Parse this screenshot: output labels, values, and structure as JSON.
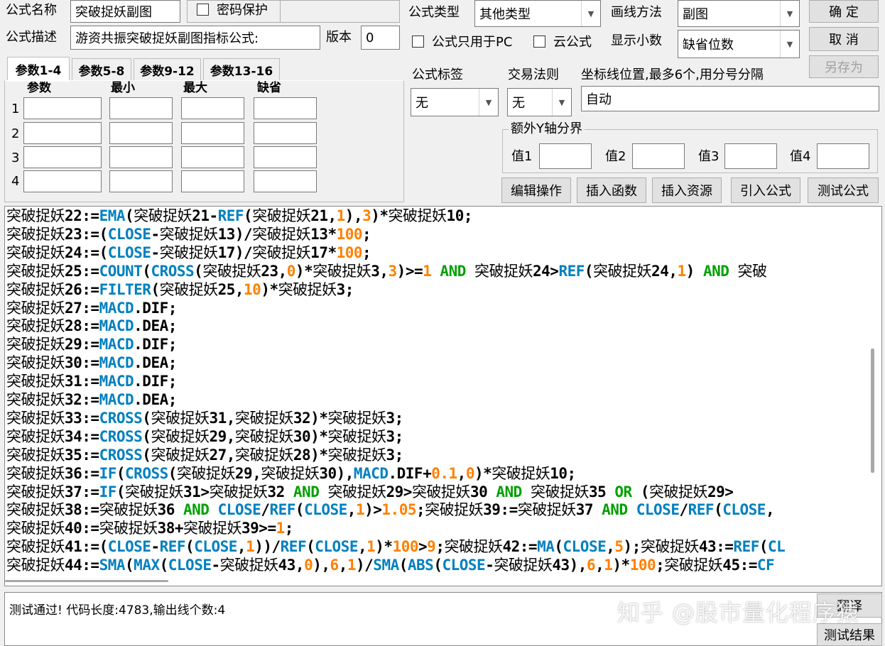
{
  "formula": {
    "name_label": "公式名称",
    "name_value": "突破捉妖副图",
    "password_label": "密码保护",
    "desc_label": "公式描述",
    "desc_value": "游资共振突破捉妖副图指标公式:",
    "version_label": "版本",
    "version_value": "0",
    "type_label": "公式类型",
    "type_value": "其他类型",
    "draw_label": "画线方法",
    "draw_value": "副图",
    "pc_only_label": "公式只用于PC",
    "cloud_label": "云公式",
    "decimals_label": "显示小数",
    "decimals_value": "缺省位数",
    "tag_label": "公式标签",
    "tag_value": "无",
    "trade_label": "交易法则",
    "trade_value": "无",
    "coord_label": "坐标线位置,最多6个,用分号分隔",
    "coord_value": "自动",
    "extra_y_label": "额外Y轴分界",
    "val1": "值1",
    "val2": "值2",
    "val3": "值3",
    "val4": "值4"
  },
  "buttons": {
    "ok": "确  定",
    "cancel": "取  消",
    "save_as": "另存为",
    "edit": "编辑操作",
    "insert_fn": "插入函数",
    "insert_res": "插入资源",
    "import": "引入公式",
    "test": "测试公式",
    "translate": "翻译",
    "test_result": "测试结果"
  },
  "tabs": [
    "参数1-4",
    "参数5-8",
    "参数9-12",
    "参数13-16"
  ],
  "params": {
    "headers": [
      "参数",
      "最小",
      "最大",
      "缺省"
    ],
    "rows": [
      "1",
      "2",
      "3",
      "4"
    ]
  },
  "code_lines": [
    [
      [
        "cn",
        "突破捉妖"
      ],
      [
        "p",
        "22:="
      ],
      [
        "f",
        "EMA"
      ],
      [
        "p",
        "("
      ],
      [
        "cn",
        "突破捉妖"
      ],
      [
        "p",
        "21-"
      ],
      [
        "f",
        "REF"
      ],
      [
        "p",
        "("
      ],
      [
        "cn",
        "突破捉妖"
      ],
      [
        "p",
        "21,"
      ],
      [
        "n",
        "1"
      ],
      [
        "p",
        "),"
      ],
      [
        "n",
        "3"
      ],
      [
        "p",
        ")*"
      ],
      [
        "cn",
        "突破捉妖"
      ],
      [
        "p",
        "10;"
      ]
    ],
    [
      [
        "cn",
        "突破捉妖"
      ],
      [
        "p",
        "23:=("
      ],
      [
        "f",
        "CLOSE"
      ],
      [
        "p",
        "-"
      ],
      [
        "cn",
        "突破捉妖"
      ],
      [
        "p",
        "13)/"
      ],
      [
        "cn",
        "突破捉妖"
      ],
      [
        "p",
        "13*"
      ],
      [
        "n",
        "100"
      ],
      [
        "p",
        ";"
      ]
    ],
    [
      [
        "cn",
        "突破捉妖"
      ],
      [
        "p",
        "24:=("
      ],
      [
        "f",
        "CLOSE"
      ],
      [
        "p",
        "-"
      ],
      [
        "cn",
        "突破捉妖"
      ],
      [
        "p",
        "17)/"
      ],
      [
        "cn",
        "突破捉妖"
      ],
      [
        "p",
        "17*"
      ],
      [
        "n",
        "100"
      ],
      [
        "p",
        ";"
      ]
    ],
    [
      [
        "cn",
        "突破捉妖"
      ],
      [
        "p",
        "25:="
      ],
      [
        "f",
        "COUNT"
      ],
      [
        "p",
        "("
      ],
      [
        "f",
        "CROSS"
      ],
      [
        "p",
        "("
      ],
      [
        "cn",
        "突破捉妖"
      ],
      [
        "p",
        "23,"
      ],
      [
        "n",
        "0"
      ],
      [
        "p",
        ")*"
      ],
      [
        "cn",
        "突破捉妖"
      ],
      [
        "p",
        "3,"
      ],
      [
        "n",
        "3"
      ],
      [
        "p",
        ")>="
      ],
      [
        "n",
        "1"
      ],
      [
        "p",
        " "
      ],
      [
        "k",
        "AND"
      ],
      [
        "p",
        " "
      ],
      [
        "cn",
        "突破捉妖"
      ],
      [
        "p",
        "24>"
      ],
      [
        "f",
        "REF"
      ],
      [
        "p",
        "("
      ],
      [
        "cn",
        "突破捉妖"
      ],
      [
        "p",
        "24,"
      ],
      [
        "n",
        "1"
      ],
      [
        "p",
        ") "
      ],
      [
        "k",
        "AND"
      ],
      [
        "p",
        " "
      ],
      [
        "cn",
        "突破"
      ]
    ],
    [
      [
        "cn",
        "突破捉妖"
      ],
      [
        "p",
        "26:="
      ],
      [
        "f",
        "FILTER"
      ],
      [
        "p",
        "("
      ],
      [
        "cn",
        "突破捉妖"
      ],
      [
        "p",
        "25,"
      ],
      [
        "n",
        "10"
      ],
      [
        "p",
        ")*"
      ],
      [
        "cn",
        "突破捉妖"
      ],
      [
        "p",
        "3;"
      ]
    ],
    [
      [
        "cn",
        "突破捉妖"
      ],
      [
        "p",
        "27:="
      ],
      [
        "f",
        "MACD"
      ],
      [
        "p",
        ".DIF;"
      ]
    ],
    [
      [
        "cn",
        "突破捉妖"
      ],
      [
        "p",
        "28:="
      ],
      [
        "f",
        "MACD"
      ],
      [
        "p",
        ".DEA;"
      ]
    ],
    [
      [
        "cn",
        "突破捉妖"
      ],
      [
        "p",
        "29:="
      ],
      [
        "f",
        "MACD"
      ],
      [
        "p",
        ".DIF;"
      ]
    ],
    [
      [
        "cn",
        "突破捉妖"
      ],
      [
        "p",
        "30:="
      ],
      [
        "f",
        "MACD"
      ],
      [
        "p",
        ".DEA;"
      ]
    ],
    [
      [
        "cn",
        "突破捉妖"
      ],
      [
        "p",
        "31:="
      ],
      [
        "f",
        "MACD"
      ],
      [
        "p",
        ".DIF;"
      ]
    ],
    [
      [
        "cn",
        "突破捉妖"
      ],
      [
        "p",
        "32:="
      ],
      [
        "f",
        "MACD"
      ],
      [
        "p",
        ".DEA;"
      ]
    ],
    [
      [
        "cn",
        "突破捉妖"
      ],
      [
        "p",
        "33:="
      ],
      [
        "f",
        "CROSS"
      ],
      [
        "p",
        "("
      ],
      [
        "cn",
        "突破捉妖"
      ],
      [
        "p",
        "31,"
      ],
      [
        "cn",
        "突破捉妖"
      ],
      [
        "p",
        "32)*"
      ],
      [
        "cn",
        "突破捉妖"
      ],
      [
        "p",
        "3;"
      ]
    ],
    [
      [
        "cn",
        "突破捉妖"
      ],
      [
        "p",
        "34:="
      ],
      [
        "f",
        "CROSS"
      ],
      [
        "p",
        "("
      ],
      [
        "cn",
        "突破捉妖"
      ],
      [
        "p",
        "29,"
      ],
      [
        "cn",
        "突破捉妖"
      ],
      [
        "p",
        "30)*"
      ],
      [
        "cn",
        "突破捉妖"
      ],
      [
        "p",
        "3;"
      ]
    ],
    [
      [
        "cn",
        "突破捉妖"
      ],
      [
        "p",
        "35:="
      ],
      [
        "f",
        "CROSS"
      ],
      [
        "p",
        "("
      ],
      [
        "cn",
        "突破捉妖"
      ],
      [
        "p",
        "27,"
      ],
      [
        "cn",
        "突破捉妖"
      ],
      [
        "p",
        "28)*"
      ],
      [
        "cn",
        "突破捉妖"
      ],
      [
        "p",
        "3;"
      ]
    ],
    [
      [
        "cn",
        "突破捉妖"
      ],
      [
        "p",
        "36:="
      ],
      [
        "f",
        "IF"
      ],
      [
        "p",
        "("
      ],
      [
        "f",
        "CROSS"
      ],
      [
        "p",
        "("
      ],
      [
        "cn",
        "突破捉妖"
      ],
      [
        "p",
        "29,"
      ],
      [
        "cn",
        "突破捉妖"
      ],
      [
        "p",
        "30),"
      ],
      [
        "f",
        "MACD"
      ],
      [
        "p",
        ".DIF+"
      ],
      [
        "n",
        "0.1"
      ],
      [
        "p",
        ","
      ],
      [
        "n",
        "0"
      ],
      [
        "p",
        ")*"
      ],
      [
        "cn",
        "突破捉妖"
      ],
      [
        "p",
        "10;"
      ]
    ],
    [
      [
        "cn",
        "突破捉妖"
      ],
      [
        "p",
        "37:="
      ],
      [
        "f",
        "IF"
      ],
      [
        "p",
        "("
      ],
      [
        "cn",
        "突破捉妖"
      ],
      [
        "p",
        "31>"
      ],
      [
        "cn",
        "突破捉妖"
      ],
      [
        "p",
        "32 "
      ],
      [
        "k",
        "AND"
      ],
      [
        "p",
        " "
      ],
      [
        "cn",
        "突破捉妖"
      ],
      [
        "p",
        "29>"
      ],
      [
        "cn",
        "突破捉妖"
      ],
      [
        "p",
        "30 "
      ],
      [
        "k",
        "AND"
      ],
      [
        "p",
        " "
      ],
      [
        "cn",
        "突破捉妖"
      ],
      [
        "p",
        "35 "
      ],
      [
        "k",
        "OR"
      ],
      [
        "p",
        " ("
      ],
      [
        "cn",
        "突破捉妖"
      ],
      [
        "p",
        "29>"
      ]
    ],
    [
      [
        "cn",
        "突破捉妖"
      ],
      [
        "p",
        "38:="
      ],
      [
        "cn",
        "突破捉妖"
      ],
      [
        "p",
        "36 "
      ],
      [
        "k",
        "AND"
      ],
      [
        "p",
        " "
      ],
      [
        "f",
        "CLOSE"
      ],
      [
        "p",
        "/"
      ],
      [
        "f",
        "REF"
      ],
      [
        "p",
        "("
      ],
      [
        "f",
        "CLOSE"
      ],
      [
        "p",
        ","
      ],
      [
        "n",
        "1"
      ],
      [
        "p",
        ")>"
      ],
      [
        "n",
        "1.05"
      ],
      [
        "p",
        ";"
      ],
      [
        "cn",
        "突破捉妖"
      ],
      [
        "p",
        "39:="
      ],
      [
        "cn",
        "突破捉妖"
      ],
      [
        "p",
        "37 "
      ],
      [
        "k",
        "AND"
      ],
      [
        "p",
        " "
      ],
      [
        "f",
        "CLOSE"
      ],
      [
        "p",
        "/"
      ],
      [
        "f",
        "REF"
      ],
      [
        "p",
        "("
      ],
      [
        "f",
        "CLOSE"
      ],
      [
        "p",
        ","
      ]
    ],
    [
      [
        "cn",
        "突破捉妖"
      ],
      [
        "p",
        "40:="
      ],
      [
        "cn",
        "突破捉妖"
      ],
      [
        "p",
        "38+"
      ],
      [
        "cn",
        "突破捉妖"
      ],
      [
        "p",
        "39>="
      ],
      [
        "n",
        "1"
      ],
      [
        "p",
        ";"
      ]
    ],
    [
      [
        "cn",
        "突破捉妖"
      ],
      [
        "p",
        "41:=("
      ],
      [
        "f",
        "CLOSE"
      ],
      [
        "p",
        "-"
      ],
      [
        "f",
        "REF"
      ],
      [
        "p",
        "("
      ],
      [
        "f",
        "CLOSE"
      ],
      [
        "p",
        ","
      ],
      [
        "n",
        "1"
      ],
      [
        "p",
        "))/"
      ],
      [
        "f",
        "REF"
      ],
      [
        "p",
        "("
      ],
      [
        "f",
        "CLOSE"
      ],
      [
        "p",
        ","
      ],
      [
        "n",
        "1"
      ],
      [
        "p",
        ")*"
      ],
      [
        "n",
        "100"
      ],
      [
        "p",
        ">"
      ],
      [
        "n",
        "9"
      ],
      [
        "p",
        ";"
      ],
      [
        "cn",
        "突破捉妖"
      ],
      [
        "p",
        "42:="
      ],
      [
        "f",
        "MA"
      ],
      [
        "p",
        "("
      ],
      [
        "f",
        "CLOSE"
      ],
      [
        "p",
        ","
      ],
      [
        "n",
        "5"
      ],
      [
        "p",
        ");"
      ],
      [
        "cn",
        "突破捉妖"
      ],
      [
        "p",
        "43:="
      ],
      [
        "f",
        "REF"
      ],
      [
        "p",
        "("
      ],
      [
        "f",
        "CL"
      ]
    ],
    [
      [
        "cn",
        "突破捉妖"
      ],
      [
        "p",
        "44:="
      ],
      [
        "f",
        "SMA"
      ],
      [
        "p",
        "("
      ],
      [
        "f",
        "MAX"
      ],
      [
        "p",
        "("
      ],
      [
        "f",
        "CLOSE"
      ],
      [
        "p",
        "-"
      ],
      [
        "cn",
        "突破捉妖"
      ],
      [
        "p",
        "43,"
      ],
      [
        "n",
        "0"
      ],
      [
        "p",
        "),"
      ],
      [
        "n",
        "6"
      ],
      [
        "p",
        ","
      ],
      [
        "n",
        "1"
      ],
      [
        "p",
        ")/"
      ],
      [
        "f",
        "SMA"
      ],
      [
        "p",
        "("
      ],
      [
        "f",
        "ABS"
      ],
      [
        "p",
        "("
      ],
      [
        "f",
        "CLOSE"
      ],
      [
        "p",
        "-"
      ],
      [
        "cn",
        "突破捉妖"
      ],
      [
        "p",
        "43),"
      ],
      [
        "n",
        "6"
      ],
      [
        "p",
        ","
      ],
      [
        "n",
        "1"
      ],
      [
        "p",
        ")*"
      ],
      [
        "n",
        "100"
      ],
      [
        "p",
        ";"
      ],
      [
        "cn",
        "突破捉妖"
      ],
      [
        "p",
        "45:="
      ],
      [
        "f",
        "CF"
      ]
    ]
  ],
  "status_message": "测试通过! 代码长度:4783,输出线个数:4",
  "watermark": "知乎 @股市量化程序猿"
}
